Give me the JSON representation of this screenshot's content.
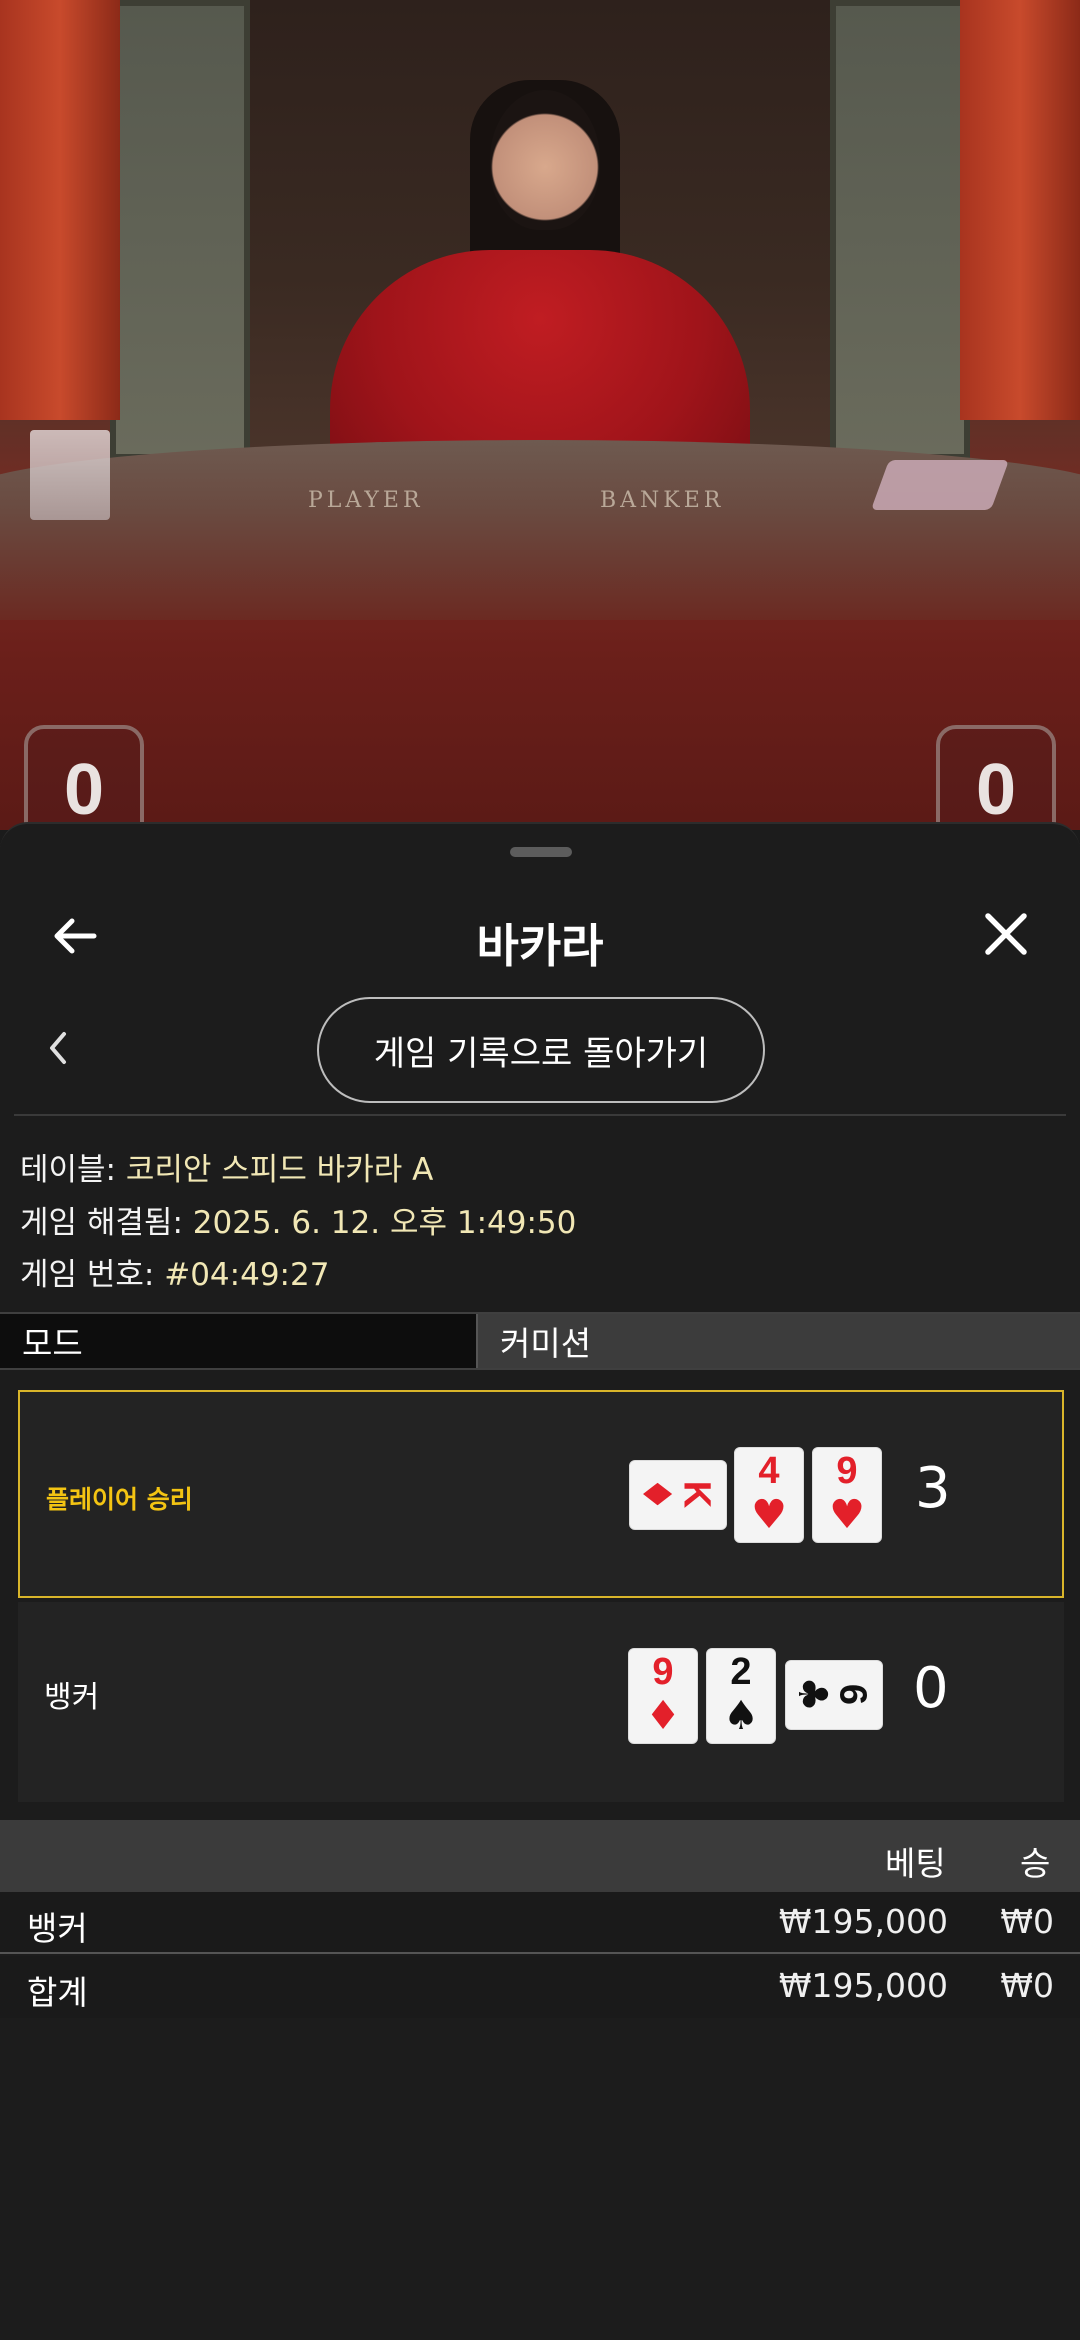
{
  "video": {
    "table_labels": {
      "player": "PLAYER",
      "banker": "BANKER"
    },
    "scores": {
      "player": "0",
      "banker": "0"
    }
  },
  "sheet": {
    "title": "바카라",
    "history_button": "게임 기록으로 돌아가기",
    "info": {
      "table_label": "테이블: ",
      "table_value": "코리안 스피드 바카라 A",
      "resolved_label": "게임 해결됨: ",
      "resolved_value": "2025. 6. 12. 오후 1:49:50",
      "number_label": "게임 번호: ",
      "number_value": "#04:49:27"
    },
    "tabs": {
      "mode": "모드",
      "commission": "커미션"
    },
    "rows": {
      "player": {
        "label": "플레이어 승리",
        "score": "3",
        "cards": [
          {
            "rank": "K",
            "suit": "♦",
            "orientation": "side",
            "color": "#e3202a"
          },
          {
            "rank": "4",
            "suit": "♥",
            "orientation": "up",
            "color": "#e3202a"
          },
          {
            "rank": "9",
            "suit": "♥",
            "orientation": "up",
            "color": "#e3202a"
          }
        ]
      },
      "banker": {
        "label": "뱅커",
        "score": "0",
        "cards": [
          {
            "rank": "9",
            "suit": "♦",
            "orientation": "up",
            "color": "#e3202a"
          },
          {
            "rank": "2",
            "suit": "♠",
            "orientation": "up",
            "color": "#111111"
          },
          {
            "rank": "6",
            "suit": "♣",
            "orientation": "side",
            "color": "#111111"
          }
        ]
      }
    },
    "bets": {
      "header_bet": "베팅",
      "header_win": "승",
      "rows": [
        {
          "name": "뱅커",
          "bet": "₩195,000",
          "win": "₩0"
        },
        {
          "name": "합계",
          "bet": "₩195,000",
          "win": "₩0"
        }
      ]
    },
    "colors": {
      "accent": "#f3c413",
      "card_red": "#e3202a"
    },
    "icons": {
      "back": "arrow-left-icon",
      "close": "close-icon",
      "prev": "chevron-left-icon"
    }
  }
}
